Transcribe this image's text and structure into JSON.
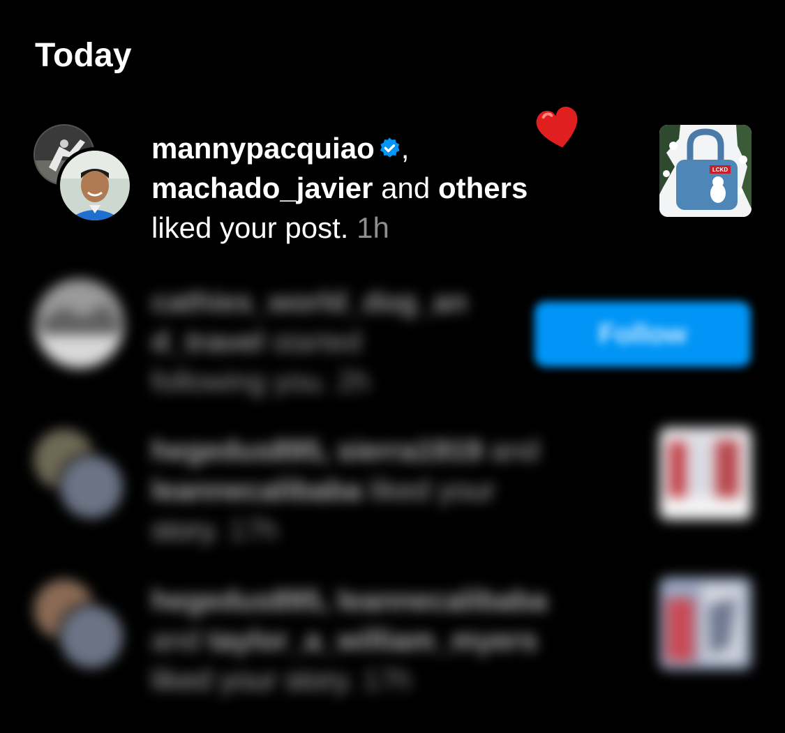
{
  "section": {
    "title": "Today"
  },
  "notifications": [
    {
      "user1": "mannypacquiao",
      "comma": ",",
      "user2": "machado_javier",
      "connector": " and ",
      "others": "others",
      "action": "liked your post.",
      "time": "1h"
    },
    {
      "user1": "cathies_world_dog_an",
      "user1b": "d_travel",
      "action": " started",
      "action2": "following you.",
      "time": "2h",
      "button": "Follow"
    },
    {
      "users": "hegedus895, sierra1919",
      "connector": " and",
      "user3": "leannecalibaba",
      "action": " liked your",
      "action2": "story.",
      "time": "17h"
    },
    {
      "users": "hegedus895, leannecalibaba",
      "connector": "and ",
      "user3": "taylor_a_william_myers",
      "action": "liked your story.",
      "time": "17h"
    }
  ],
  "thumb": {
    "label": "LCKD"
  },
  "colors": {
    "accent": "#0095f6",
    "verified": "#0095f6",
    "heart": "#e0201f"
  },
  "icons": {
    "verified": "verified-badge-icon",
    "heart": "heart-icon"
  }
}
